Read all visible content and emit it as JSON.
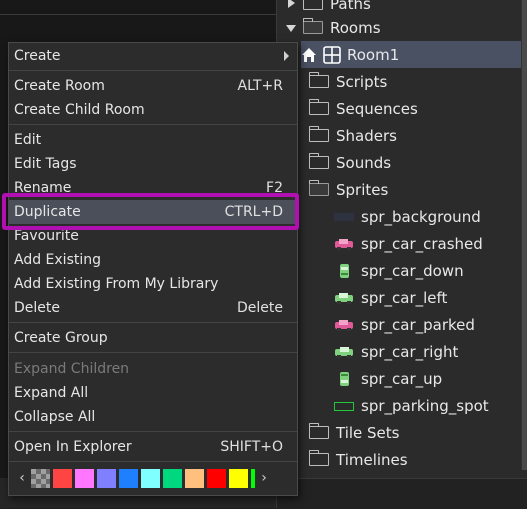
{
  "context_menu": {
    "items": [
      {
        "label": "Create",
        "shortcut": "",
        "submenu": true,
        "disabled": false
      },
      {
        "label": "Create Room",
        "shortcut": "ALT+R",
        "disabled": false
      },
      {
        "label": "Create Child Room",
        "shortcut": "",
        "disabled": false
      },
      {
        "label": "Edit",
        "shortcut": "",
        "disabled": false
      },
      {
        "label": "Edit Tags",
        "shortcut": "",
        "disabled": false
      },
      {
        "label": "Rename",
        "shortcut": "F2",
        "disabled": false
      },
      {
        "label": "Duplicate",
        "shortcut": "CTRL+D",
        "disabled": false,
        "highlighted": true
      },
      {
        "label": "Favourite",
        "shortcut": "",
        "disabled": false
      },
      {
        "label": "Add Existing",
        "shortcut": "",
        "disabled": false
      },
      {
        "label": "Add Existing From My Library",
        "shortcut": "",
        "disabled": false
      },
      {
        "label": "Delete",
        "shortcut": "Delete",
        "disabled": false
      },
      {
        "label": "Create Group",
        "shortcut": "",
        "disabled": false
      },
      {
        "label": "Expand Children",
        "shortcut": "",
        "disabled": true
      },
      {
        "label": "Expand All",
        "shortcut": "",
        "disabled": false
      },
      {
        "label": "Collapse All",
        "shortcut": "",
        "disabled": false
      },
      {
        "label": "Open In Explorer",
        "shortcut": "SHIFT+O",
        "disabled": false
      }
    ],
    "swatches": [
      "#ff4444",
      "#ff77ff",
      "#7f7fff",
      "#1e7fff",
      "#7fffff",
      "#00d87f",
      "#ffbf7f",
      "#ff0000",
      "#ffff00",
      "#00ff00"
    ],
    "highlight_color": "#b10fb1"
  },
  "asset_tree": {
    "rows": [
      {
        "label": "Paths",
        "type": "folder",
        "expanded": false
      },
      {
        "label": "Rooms",
        "type": "folder",
        "expanded": true
      },
      {
        "label": "Room1",
        "type": "room",
        "selected": true
      },
      {
        "label": "Scripts",
        "type": "folder"
      },
      {
        "label": "Sequences",
        "type": "folder"
      },
      {
        "label": "Shaders",
        "type": "folder"
      },
      {
        "label": "Sounds",
        "type": "folder"
      },
      {
        "label": "Sprites",
        "type": "folder",
        "expanded": true
      },
      {
        "label": "spr_background",
        "type": "sprite",
        "thumb": "bg"
      },
      {
        "label": "spr_car_crashed",
        "type": "sprite",
        "thumb": "pink"
      },
      {
        "label": "spr_car_down",
        "type": "sprite",
        "thumb": "green-v"
      },
      {
        "label": "spr_car_left",
        "type": "sprite",
        "thumb": "green"
      },
      {
        "label": "spr_car_parked",
        "type": "sprite",
        "thumb": "pink"
      },
      {
        "label": "spr_car_right",
        "type": "sprite",
        "thumb": "green"
      },
      {
        "label": "spr_car_up",
        "type": "sprite",
        "thumb": "green-v"
      },
      {
        "label": "spr_parking_spot",
        "type": "sprite",
        "thumb": "outline"
      },
      {
        "label": "Tile Sets",
        "type": "folder"
      },
      {
        "label": "Timelines",
        "type": "folder"
      }
    ]
  }
}
